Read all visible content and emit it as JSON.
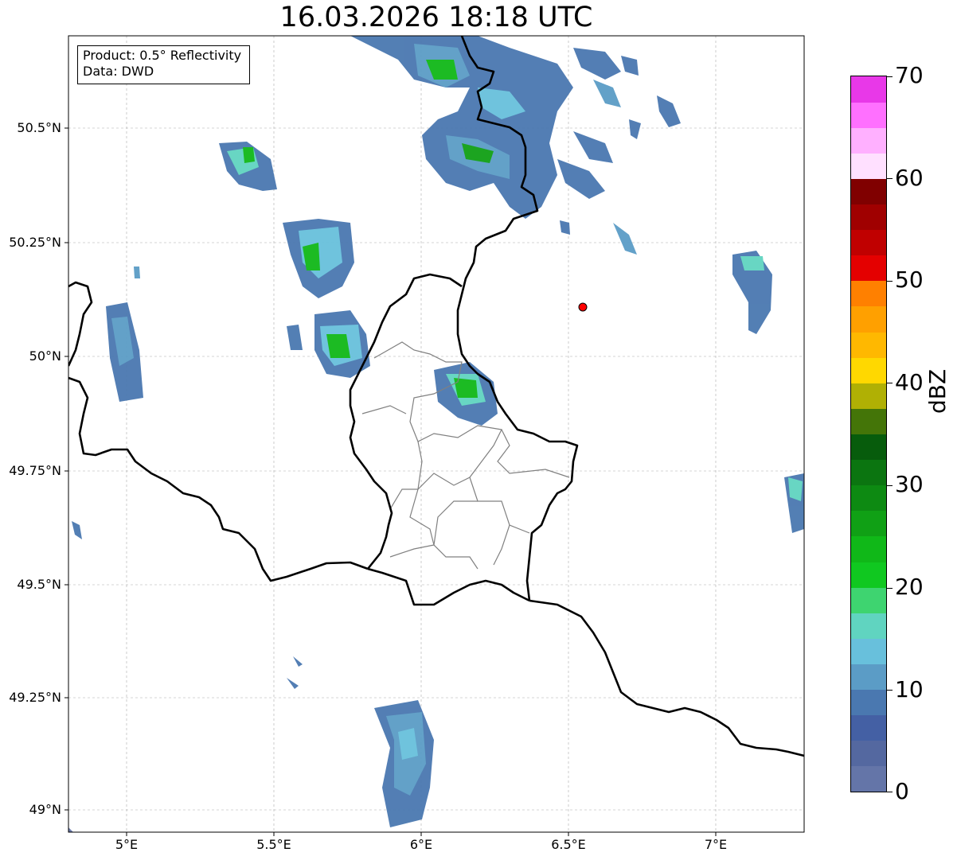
{
  "title": "16.03.2026 18:18 UTC",
  "info": {
    "product": "Product: 0.5° Reflectivity",
    "data": "Data: DWD"
  },
  "axes": {
    "lat_ticks": [
      "50.5°N",
      "50.25°N",
      "50°N",
      "49.75°N",
      "49.5°N",
      "49.25°N",
      "49°N"
    ],
    "lon_ticks": [
      "5°E",
      "5.5°E",
      "6°E",
      "6.5°E",
      "7°E"
    ],
    "lon_range": [
      4.8,
      7.3
    ],
    "lat_range": [
      48.95,
      50.7
    ],
    "grid": true
  },
  "marker": {
    "name": "radar site",
    "lon": 6.55,
    "lat": 50.11,
    "color": "#ff0000"
  },
  "colorbar": {
    "unit": "dBZ",
    "ticks": [
      "0",
      "10",
      "20",
      "30",
      "40",
      "50",
      "60",
      "70"
    ],
    "range": [
      0,
      70
    ],
    "colors": [
      "#6475a8",
      "#5468a0",
      "#4460a4",
      "#4a78b0",
      "#5b9cc6",
      "#68c0dc",
      "#60d4c0",
      "#3ed470",
      "#10c820",
      "#10b818",
      "#10a015",
      "#0d8a12",
      "#0b7510",
      "#075c0c",
      "#447508",
      "#b0b004",
      "#ffd800",
      "#ffb800",
      "#ffa000",
      "#ff8000",
      "#e40000",
      "#c00000",
      "#a00000",
      "#800000",
      "#ffe0ff",
      "#ffb0ff",
      "#ff70ff",
      "#e838e8"
    ]
  }
}
